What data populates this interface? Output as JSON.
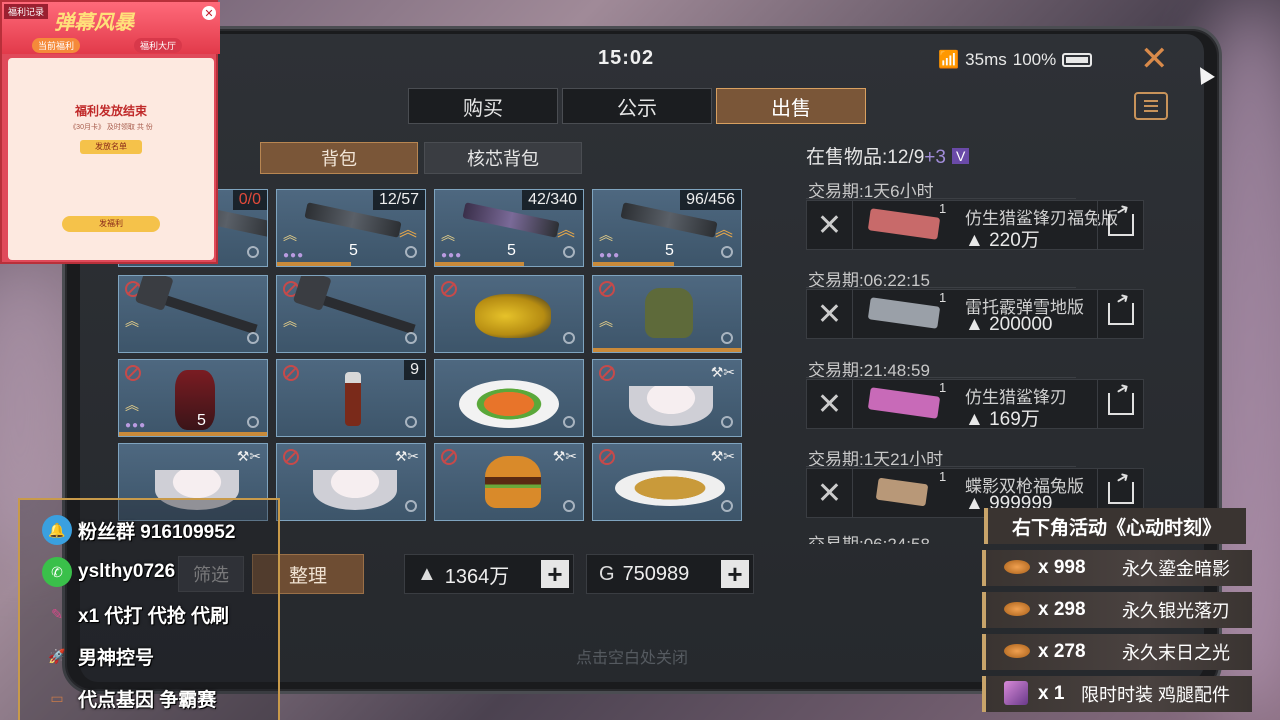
{
  "status": {
    "time": "15:02",
    "ping": "35ms",
    "battery": "100%"
  },
  "tabs": [
    {
      "label": "购买",
      "active": false
    },
    {
      "label": "公示",
      "active": false
    },
    {
      "label": "出售",
      "active": true
    }
  ],
  "subtabs": {
    "bag": "背包",
    "core": "核芯背包"
  },
  "grid": {
    "row0": [
      {
        "count": "0/0",
        "level": "",
        "icon": "rifle"
      },
      {
        "count": "12/57",
        "level": "5",
        "icon": "rifle"
      },
      {
        "count": "42/340",
        "level": "5",
        "icon": "purple-rifle"
      },
      {
        "count": "96/456",
        "level": "5",
        "icon": "rifle"
      }
    ],
    "row1": [
      {
        "icon": "axe"
      },
      {
        "icon": "axe"
      },
      {
        "icon": "yellow-backpack"
      },
      {
        "icon": "armor-vest"
      }
    ],
    "row2": [
      {
        "icon": "red-suit",
        "level": "5"
      },
      {
        "icon": "bottle",
        "count": "9"
      },
      {
        "icon": "shrimp-plate"
      },
      {
        "icon": "dumpling-bowl"
      }
    ],
    "row3": [
      {
        "icon": "dumpling-bowl"
      },
      {
        "icon": "dumpling-bowl"
      },
      {
        "icon": "burger"
      },
      {
        "icon": "fish-plate"
      }
    ]
  },
  "controls": {
    "filter_label": "筛选",
    "sort_label": "整理",
    "silver": "1364万",
    "gold": "750989"
  },
  "hint": "点击空白处关闭",
  "sale": {
    "header": "在售物品:12/9",
    "bonus": "+3",
    "vip": "V",
    "items": [
      {
        "period": "交易期:1天6小时",
        "qty": "1",
        "name": "仿生猎鲨锋刃福兔版",
        "price": "220万",
        "color": "#c86a6a"
      },
      {
        "period": "交易期:06:22:15",
        "qty": "1",
        "name": "雷托霰弹雪地版",
        "price": "200000",
        "color": "#9aa0a8"
      },
      {
        "period": "交易期:21:48:59",
        "qty": "1",
        "name": "仿生猎鲨锋刃",
        "price": "169万",
        "color": "#c86ab8"
      },
      {
        "period": "交易期:1天21小时",
        "qty": "1",
        "name": "蝶影双枪福兔版",
        "price": "999999",
        "color": "#b89878"
      }
    ],
    "partial_period": "交易期:06:24:58"
  },
  "promo": {
    "record": "福利记录",
    "title": "弹幕风暴",
    "tab1": "当前福利",
    "tab2": "福利大厅",
    "heading": "福利发放结束",
    "sub": "《30月卡》 及时领取 共 份",
    "list_btn": "发放名单",
    "action_btn": "发福利"
  },
  "social": [
    {
      "icon": "bell-icon",
      "text": "粉丝群 916109952",
      "color": "#3aa0e0"
    },
    {
      "icon": "wechat-icon",
      "text": "yslthy0726",
      "color": "#3ac04a"
    },
    {
      "icon": "pen-icon",
      "text": "x1 代打 代抢 代刷",
      "color": "#d84a8a"
    },
    {
      "icon": "rocket-icon",
      "text": "男神控号",
      "color": "#9a4ad8"
    },
    {
      "icon": "card-icon",
      "text": "代点基因 争霸赛",
      "color": "#c87a4a"
    }
  ],
  "activity": {
    "title": "右下角活动《心动时刻》",
    "items": [
      {
        "count": "x 998",
        "name": "永久鎏金暗影"
      },
      {
        "count": "x 298",
        "name": "永久银光落刃"
      },
      {
        "count": "x 278",
        "name": "永久末日之光"
      },
      {
        "count": "x 1",
        "name": "限时时装 鸡腿配件"
      }
    ]
  }
}
